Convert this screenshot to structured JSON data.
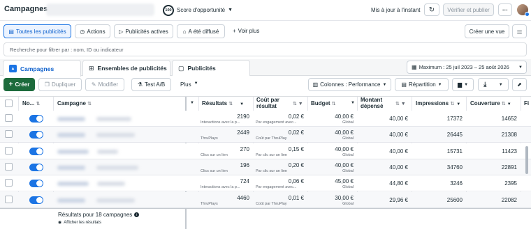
{
  "header": {
    "title": "Campagnes",
    "opportunity_score_value": "100",
    "opportunity_score_label": "Score d'opportunité",
    "updated_text": "Mis à jour à l'instant",
    "verify_publish_label": "Vérifier et publier",
    "more_label": "···"
  },
  "filters": {
    "all_ads": "Toutes les publicités",
    "actions": "Actions",
    "active_ads": "Publicités actives",
    "was_shared": "A été diffusé",
    "see_more": "Voir plus",
    "create_view": "Créer une vue",
    "search_placeholder": "Recherche pour filtrer par : nom, ID ou indicateur"
  },
  "tabs": {
    "campaigns": "Campagnes",
    "adsets": "Ensembles de publicités",
    "ads": "Publicités",
    "date_range": "Maximum : 25 juil 2023 – 25 août 2026"
  },
  "toolbar": {
    "create": "Créer",
    "duplicate": "Dupliquer",
    "edit": "Modifier",
    "ab_test": "Test A/B",
    "more": "Plus",
    "columns": "Colonnes : Performance",
    "breakdown": "Répartition"
  },
  "columns": {
    "status": "No...",
    "campaign": "Campagne",
    "results": "Résultats",
    "cost_per_result_1": "Coût par",
    "cost_per_result_2": "résultat",
    "budget": "Budget",
    "amount_spent_1": "Montant",
    "amount_spent_2": "dépensé",
    "impressions": "Impressions",
    "reach": "Couverture",
    "extra": "Fi"
  },
  "rows": [
    {
      "results": "2190",
      "results_sub": "Interactions avec la p...",
      "cost": "0,02 €",
      "cost_sub": "Par engagement avec...",
      "budget": "40,00 €",
      "budget_sub": "Global",
      "spent": "40,00 €",
      "impressions": "17372",
      "reach": "14652"
    },
    {
      "results": "2449",
      "results_sub": "ThruPlays",
      "cost": "0,02 €",
      "cost_sub": "Coût par ThruPlay",
      "budget": "40,00 €",
      "budget_sub": "Global",
      "spent": "40,00 €",
      "impressions": "26445",
      "reach": "21308"
    },
    {
      "results": "270",
      "results_sub": "Clics sur un lien",
      "cost": "0,15 €",
      "cost_sub": "Par clic sur un lien",
      "budget": "40,00 €",
      "budget_sub": "Global",
      "spent": "40,00 €",
      "impressions": "15731",
      "reach": "11423"
    },
    {
      "results": "196",
      "results_sub": "Clics sur un lien",
      "cost": "0,20 €",
      "cost_sub": "Par clic sur un lien",
      "budget": "40,00 €",
      "budget_sub": "Global",
      "spent": "40,00 €",
      "impressions": "34760",
      "reach": "22891"
    },
    {
      "results": "724",
      "results_sub": "Interactions avec la p...",
      "cost": "0,06 €",
      "cost_sub": "Par engagement avec...",
      "budget": "45,00 €",
      "budget_sub": "Global",
      "spent": "44,80 €",
      "impressions": "3246",
      "reach": "2395"
    },
    {
      "results": "4460",
      "results_sub": "ThruPlays",
      "cost": "0,01 €",
      "cost_sub": "Coût par ThruPlay",
      "budget": "30,00 €",
      "budget_sub": "Global",
      "spent": "29,96 €",
      "impressions": "25600",
      "reach": "22082"
    }
  ],
  "footer": {
    "results_text": "Résultats pour 18 campagnes",
    "show_results": "Afficher les résultats"
  },
  "colors": {
    "accent": "#1b74e4",
    "create_green": "#1d6b3c"
  }
}
